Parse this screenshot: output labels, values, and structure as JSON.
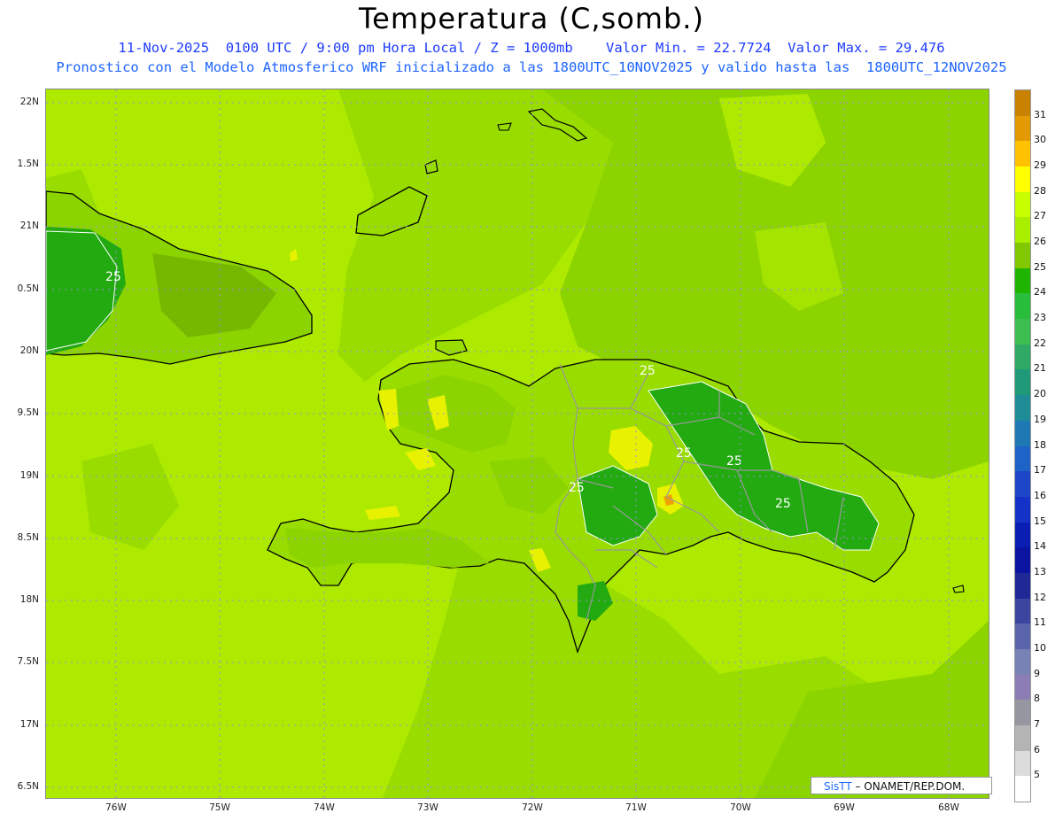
{
  "title": "Temperatura (C,somb.)",
  "subtitle_line1": "11-Nov-2025  0100 UTC / 9:00 pm Hora Local / Z = 1000mb    Valor Min. = 22.7724  Valor Max. = 29.476",
  "subtitle_line2": "Pronostico con el Modelo Atmosferico WRF inicializado a las 1800UTC_10NOV2025 y valido hasta las  1800UTC_12NOV2025",
  "lat_labels": [
    "22N",
    "1.5N",
    "21N",
    "0.5N",
    "20N",
    "9.5N",
    "19N",
    "8.5N",
    "18N",
    "7.5N",
    "17N",
    "6.5N"
  ],
  "lon_labels": [
    "76W",
    "75W",
    "74W",
    "73W",
    "72W",
    "71W",
    "70W",
    "69W",
    "68W"
  ],
  "contour_labels": [
    "25",
    "25",
    "25",
    "25",
    "25",
    "25"
  ],
  "colorbar": {
    "labels": [
      "31",
      "30",
      "29",
      "28",
      "27",
      "26",
      "25",
      "24",
      "23",
      "22",
      "21",
      "20",
      "19",
      "18",
      "17",
      "16",
      "15",
      "14",
      "13",
      "12",
      "11",
      "10",
      "9",
      "8",
      "7",
      "6",
      "5"
    ],
    "colors": [
      "#c88200",
      "#e29a00",
      "#ffc200",
      "#ffff00",
      "#c8ff00",
      "#aaee00",
      "#82c800",
      "#1eb400",
      "#28be3c",
      "#3cbe50",
      "#2eaa64",
      "#1e9a78",
      "#1e8c96",
      "#1e78b4",
      "#1e64c8",
      "#1e46c8",
      "#1432c8",
      "#0a1eb4",
      "#0a14a0",
      "#1e2896",
      "#3c46a0",
      "#5a64aa",
      "#7882b4",
      "#8c7eb4",
      "#9696a0",
      "#b4b4b4",
      "#dcdcdc",
      "#ffffff"
    ]
  },
  "credit": {
    "brand": "SisTT",
    "text": " – ONAMET/REP.DOM."
  },
  "colors": {
    "base_green": "#aeea00",
    "mid_green": "#8cd400",
    "dark_green": "#76b800",
    "deep_green": "#22aa10",
    "yellow": "#e8f200",
    "orange": "#f0a000",
    "coast": "#000000",
    "border": "#999999"
  }
}
